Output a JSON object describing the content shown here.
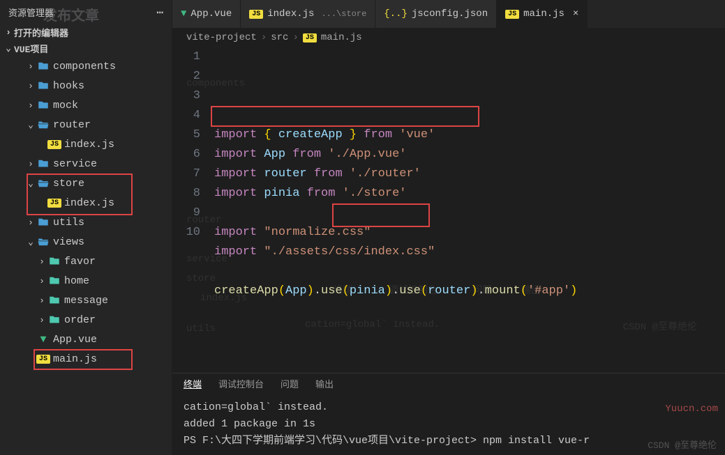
{
  "sidebar": {
    "title": "资源管理器",
    "open_editors": "打开的编辑器",
    "project_name": "VUE项目",
    "items": [
      {
        "type": "folder",
        "name": "components",
        "open": false,
        "depth": 2
      },
      {
        "type": "folder",
        "name": "hooks",
        "open": false,
        "depth": 2
      },
      {
        "type": "folder",
        "name": "mock",
        "open": false,
        "depth": 2
      },
      {
        "type": "folder",
        "name": "router",
        "open": true,
        "depth": 2
      },
      {
        "type": "file",
        "icon": "js",
        "name": "index.js",
        "depth": 3
      },
      {
        "type": "folder",
        "name": "service",
        "open": false,
        "depth": 2
      },
      {
        "type": "folder",
        "name": "store",
        "open": true,
        "depth": 2
      },
      {
        "type": "file",
        "icon": "js",
        "name": "index.js",
        "depth": 3
      },
      {
        "type": "folder",
        "name": "utils",
        "open": false,
        "depth": 2
      },
      {
        "type": "folder",
        "name": "views",
        "open": true,
        "depth": 2
      },
      {
        "type": "folder-green",
        "name": "favor",
        "open": false,
        "depth": 3
      },
      {
        "type": "folder-green",
        "name": "home",
        "open": false,
        "depth": 3
      },
      {
        "type": "folder-green",
        "name": "message",
        "open": false,
        "depth": 3
      },
      {
        "type": "folder-green",
        "name": "order",
        "open": false,
        "depth": 3
      },
      {
        "type": "file",
        "icon": "vue",
        "name": "App.vue",
        "depth": 2
      },
      {
        "type": "file",
        "icon": "js",
        "name": "main.js",
        "depth": 2
      }
    ]
  },
  "tabs": [
    {
      "icon": "vue",
      "label": "App.vue",
      "active": false
    },
    {
      "icon": "js",
      "label": "index.js",
      "hint": "...\\store",
      "active": false
    },
    {
      "icon": "jsconfig",
      "label": "jsconfig.json",
      "active": false
    },
    {
      "icon": "js",
      "label": "main.js",
      "active": true,
      "close": true
    }
  ],
  "breadcrumb": {
    "parts": [
      "vite-project",
      "src"
    ],
    "file_icon": "js",
    "file": "main.js"
  },
  "code": {
    "lines": [
      {
        "n": 1,
        "segments": [
          [
            "kw",
            "import"
          ],
          [
            "punct",
            " "
          ],
          [
            "bracket-yellow",
            "{"
          ],
          [
            "punct",
            " "
          ],
          [
            "var",
            "createApp"
          ],
          [
            "punct",
            " "
          ],
          [
            "bracket-yellow",
            "}"
          ],
          [
            "punct",
            " "
          ],
          [
            "kw",
            "from"
          ],
          [
            "punct",
            " "
          ],
          [
            "str",
            "'vue'"
          ]
        ]
      },
      {
        "n": 2,
        "segments": [
          [
            "kw",
            "import"
          ],
          [
            "punct",
            " "
          ],
          [
            "var",
            "App"
          ],
          [
            "punct",
            " "
          ],
          [
            "kw",
            "from"
          ],
          [
            "punct",
            " "
          ],
          [
            "str",
            "'./App.vue'"
          ]
        ]
      },
      {
        "n": 3,
        "segments": [
          [
            "kw",
            "import"
          ],
          [
            "punct",
            " "
          ],
          [
            "var",
            "router"
          ],
          [
            "punct",
            " "
          ],
          [
            "kw",
            "from"
          ],
          [
            "punct",
            " "
          ],
          [
            "str",
            "'./router'"
          ]
        ]
      },
      {
        "n": 4,
        "segments": [
          [
            "kw",
            "import"
          ],
          [
            "punct",
            " "
          ],
          [
            "var",
            "pinia"
          ],
          [
            "punct",
            " "
          ],
          [
            "kw",
            "from"
          ],
          [
            "punct",
            " "
          ],
          [
            "str",
            "'./store'"
          ]
        ]
      },
      {
        "n": 5,
        "segments": []
      },
      {
        "n": 6,
        "segments": [
          [
            "kw",
            "import"
          ],
          [
            "punct",
            " "
          ],
          [
            "str",
            "\"normalize.css\""
          ]
        ]
      },
      {
        "n": 7,
        "segments": [
          [
            "kw",
            "import"
          ],
          [
            "punct",
            " "
          ],
          [
            "str",
            "\"./assets/css/index.css\""
          ]
        ]
      },
      {
        "n": 8,
        "segments": []
      },
      {
        "n": 9,
        "segments": [
          [
            "fn",
            "createApp"
          ],
          [
            "bracket-yellow",
            "("
          ],
          [
            "var",
            "App"
          ],
          [
            "bracket-yellow",
            ")"
          ],
          [
            "punct",
            "."
          ],
          [
            "fn",
            "use"
          ],
          [
            "bracket-yellow",
            "("
          ],
          [
            "var",
            "pinia"
          ],
          [
            "bracket-yellow",
            ")"
          ],
          [
            "punct",
            "."
          ],
          [
            "fn",
            "use"
          ],
          [
            "bracket-yellow",
            "("
          ],
          [
            "var",
            "router"
          ],
          [
            "bracket-yellow",
            ")"
          ],
          [
            "punct",
            "."
          ],
          [
            "fn",
            "mount"
          ],
          [
            "bracket-yellow",
            "("
          ],
          [
            "str",
            "'#app'"
          ],
          [
            "bracket-yellow",
            ")"
          ]
        ]
      },
      {
        "n": 10,
        "segments": []
      }
    ]
  },
  "terminal_tabs": [
    "终端",
    "调试控制台",
    "问题",
    "输出"
  ],
  "terminal": {
    "line1": "cation=global` instead.",
    "line2": "",
    "line3": "added 1 package in 1s",
    "line4": "PS F:\\大四下学期前端学习\\代码\\vue项目\\vite-project> npm install vue-r"
  },
  "watermarks": {
    "yuucn": "Yuucn.com",
    "csdn": "CSDN @至尊绝伦"
  },
  "faded": {
    "t0": "发布文章",
    "t1": "终端",
    "t2": "调试控制台",
    "t3": "问题",
    "t4": "输出",
    "t5": "cation=global` instead.",
    "t6": "components",
    "t7": "service",
    "t8": "store",
    "t9": "index.js",
    "t10": "utils",
    "t11": "router"
  }
}
